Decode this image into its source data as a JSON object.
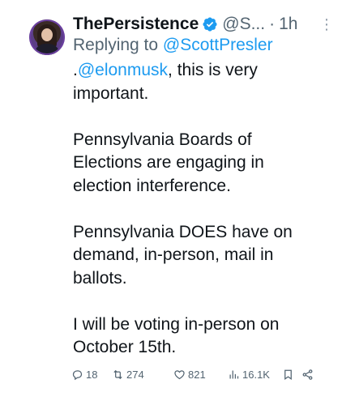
{
  "tweet": {
    "display_name": "ThePersistence",
    "handle": "@S...",
    "separator": "·",
    "time": "1h",
    "more_label": "⋮",
    "replying_prefix": "Replying to",
    "replying_to": "@ScottPresler",
    "mention_prefix": ".",
    "mention": "@elonmusk",
    "paragraphs": [
      ", this is very important.",
      "Pennsylvania Boards of Elections are engaging in election interference.",
      "Pennsylvania DOES have on demand, in-person, mail in ballots.",
      "I will be voting in-person on October 15th."
    ]
  },
  "actions": {
    "replies": "18",
    "reposts": "274",
    "likes": "821",
    "views": "16.1K"
  },
  "icons": {
    "verified": "verified-badge-icon",
    "reply": "reply-icon",
    "repost": "repost-icon",
    "like": "heart-icon",
    "views": "views-icon",
    "bookmark": "bookmark-icon",
    "share": "share-icon"
  },
  "colors": {
    "accent": "#1d9bf0",
    "text": "#0f1419",
    "muted": "#536471"
  }
}
